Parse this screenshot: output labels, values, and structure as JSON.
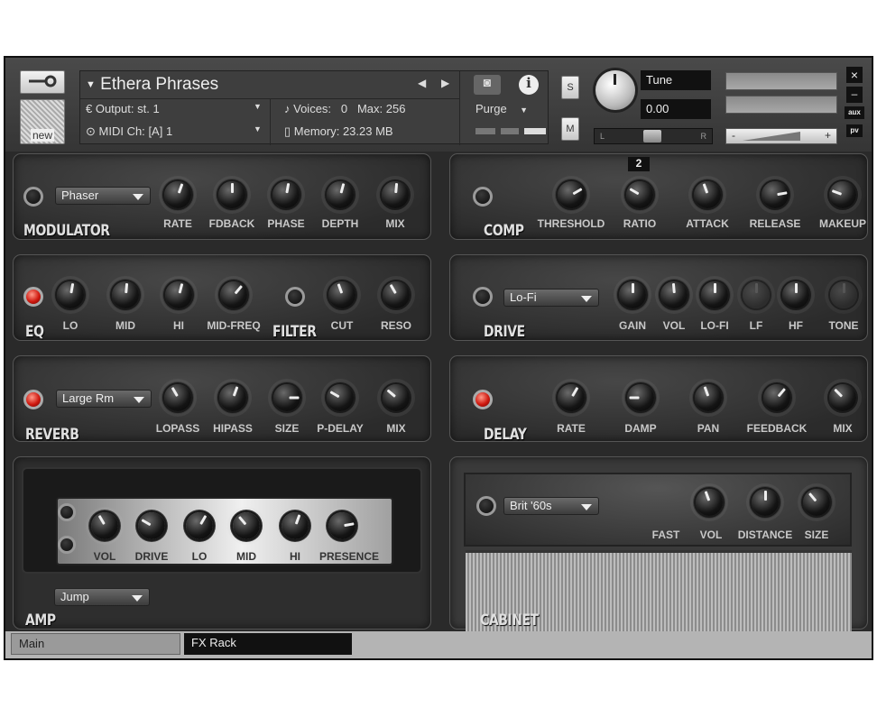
{
  "header": {
    "title": "Ethera Phrases",
    "output_label": "Output:",
    "output_value": "st. 1",
    "voices_label": "Voices:",
    "voices_value": "0",
    "max_label": "Max:",
    "max_value": "256",
    "midi_label": "MIDI Ch:",
    "midi_value": "[A] 1",
    "memory_label": "Memory:",
    "memory_value": "23.23 MB",
    "purge_label": "Purge",
    "new_label": "new",
    "s_label": "S",
    "m_label": "M",
    "tune_label": "Tune",
    "tune_value": "0.00",
    "pan_l": "L",
    "pan_r": "R",
    "vol_minus": "-",
    "vol_plus": "+",
    "close": "×",
    "minimize": "–",
    "aux": "aux",
    "pv": "pv"
  },
  "modulator": {
    "name": "MODULATOR",
    "dropdown": "Phaser",
    "knobs": [
      "RATE",
      "FDBACK",
      "PHASE",
      "DEPTH",
      "MIX"
    ]
  },
  "comp": {
    "name": "COMP",
    "value_badge": "2",
    "knobs": [
      "THRESHOLD",
      "RATIO",
      "ATTACK",
      "RELEASE",
      "MAKEUP"
    ]
  },
  "eq": {
    "name": "EQ",
    "knobs": [
      "LO",
      "MID",
      "HI",
      "MID-FREQ"
    ]
  },
  "filter": {
    "name": "FILTER",
    "knobs": [
      "CUT",
      "RESO"
    ]
  },
  "drive": {
    "name": "DRIVE",
    "dropdown": "Lo-Fi",
    "knobs": [
      "GAIN",
      "VOL",
      "LO-FI",
      "LF",
      "HF",
      "TONE"
    ]
  },
  "reverb": {
    "name": "REVERB",
    "dropdown": "Large Rm",
    "knobs": [
      "LOPASS",
      "HIPASS",
      "SIZE",
      "P-DELAY",
      "MIX"
    ]
  },
  "delay": {
    "name": "DELAY",
    "knobs": [
      "RATE",
      "DAMP",
      "PAN",
      "FEEDBACK",
      "MIX"
    ]
  },
  "amp": {
    "name": "AMP",
    "dropdown": "Jump",
    "knobs": [
      "VOL",
      "DRIVE",
      "LO",
      "MID",
      "HI",
      "PRESENCE"
    ]
  },
  "cabinet": {
    "name": "CABINET",
    "dropdown": "Brit '60s",
    "knobs": [
      "FAST",
      "VOL",
      "DISTANCE",
      "SIZE"
    ]
  },
  "tabs": [
    "Main",
    "FX Rack"
  ]
}
